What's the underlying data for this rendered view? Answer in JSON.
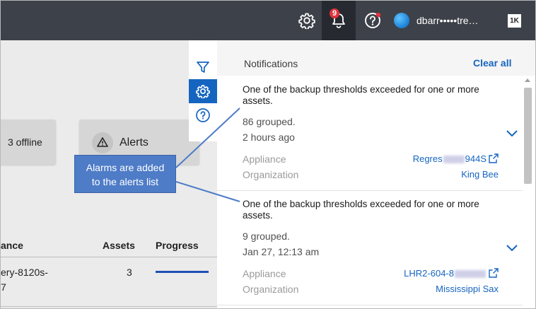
{
  "topbar": {
    "badge_count": "9",
    "username": "dbarr•••••tre…",
    "logo_text": "1K"
  },
  "background": {
    "offline_label": "3 offline",
    "alerts_label": "Alerts",
    "table": {
      "col_appliance": "ance",
      "col_assets": "Assets",
      "col_progress": "Progress",
      "row1_name_line1": "ery-8120s-",
      "row1_name_line2": "7",
      "row1_assets": "3"
    }
  },
  "panel": {
    "title": "Notifications",
    "clear_all": "Clear all",
    "notifications": [
      {
        "title": "One of the backup thresholds exceeded for one or more assets.",
        "grouped": "86 grouped.",
        "time": "2 hours ago",
        "appliance_label": "Appliance",
        "appliance_value_a": "Regres",
        "appliance_value_b": "944S",
        "organization_label": "Organization",
        "organization_value": "King Bee"
      },
      {
        "title": "One of the backup thresholds exceeded for one or more assets.",
        "grouped": "9 grouped.",
        "time": "Jan 27, 12:13 am",
        "appliance_label": "Appliance",
        "appliance_value_a": "LHR2-604-8",
        "appliance_value_b": "",
        "organization_label": "Organization",
        "organization_value": "Mississippi Sax"
      }
    ]
  },
  "callout": {
    "line1": "Alarms are added",
    "line2": "to the alerts list"
  },
  "colors": {
    "topbar": "#3d4149",
    "accent": "#1565c0",
    "badge": "#e2323c",
    "callout": "#4e7cc7"
  }
}
